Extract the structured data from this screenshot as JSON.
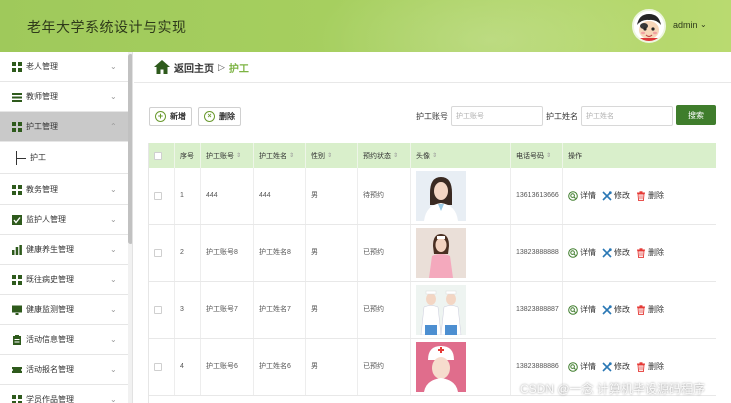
{
  "header": {
    "title": "老年大学系统设计与实现",
    "user": "admin",
    "caret": "⌄"
  },
  "sidebar": {
    "items": [
      {
        "label": "老人管理",
        "icon": "grid-icon"
      },
      {
        "label": "教师管理",
        "icon": "list-icon"
      },
      {
        "label": "护工管理",
        "icon": "grid-icon",
        "active": true,
        "sub": "护工"
      },
      {
        "label": "教务管理",
        "icon": "grid-icon"
      },
      {
        "label": "监护人管理",
        "icon": "check-icon"
      },
      {
        "label": "健康养生管理",
        "icon": "bar-chart-icon"
      },
      {
        "label": "既往病史管理",
        "icon": "grid-icon"
      },
      {
        "label": "健康监测管理",
        "icon": "monitor-icon"
      },
      {
        "label": "活动信息管理",
        "icon": "clipboard-icon"
      },
      {
        "label": "活动报名管理",
        "icon": "ticket-icon"
      },
      {
        "label": "学员作品管理",
        "icon": "grid-icon"
      }
    ]
  },
  "breadcrumb": {
    "home": "返回主页",
    "sep": "▷",
    "current": "护工"
  },
  "toolbar": {
    "add_label": "新增",
    "delete_label": "删除",
    "account_label": "护工账号",
    "account_placeholder": "护工账号",
    "name_label": "护工姓名",
    "name_placeholder": "护工姓名",
    "search_label": "搜索"
  },
  "table": {
    "columns": [
      "序号",
      "护工账号",
      "护工姓名",
      "性别",
      "预约状态",
      "头像",
      "电话号码",
      "操作"
    ],
    "sort_glyph": "⇕",
    "rows": [
      {
        "no": "1",
        "account": "444",
        "name": "444",
        "gender": "男",
        "status": "待预约",
        "phone": "13613613666"
      },
      {
        "no": "2",
        "account": "护工账号8",
        "name": "护工姓名8",
        "gender": "男",
        "status": "已预约",
        "phone": "13823888888"
      },
      {
        "no": "3",
        "account": "护工账号7",
        "name": "护工姓名7",
        "gender": "男",
        "status": "已预约",
        "phone": "13823888887"
      },
      {
        "no": "4",
        "account": "护工账号6",
        "name": "护工姓名6",
        "gender": "男",
        "status": "已预约",
        "phone": "13823888886"
      }
    ],
    "actions": {
      "detail": "详情",
      "edit": "修改",
      "delete": "删除"
    }
  },
  "watermark": "CSDN @一念 计算机毕设源码程序",
  "colors": {
    "header": "#a6cf5f",
    "accent": "#7cb342",
    "search_button": "#3f7d2c",
    "table_head": "#d9efcb",
    "delete": "#e53935"
  }
}
